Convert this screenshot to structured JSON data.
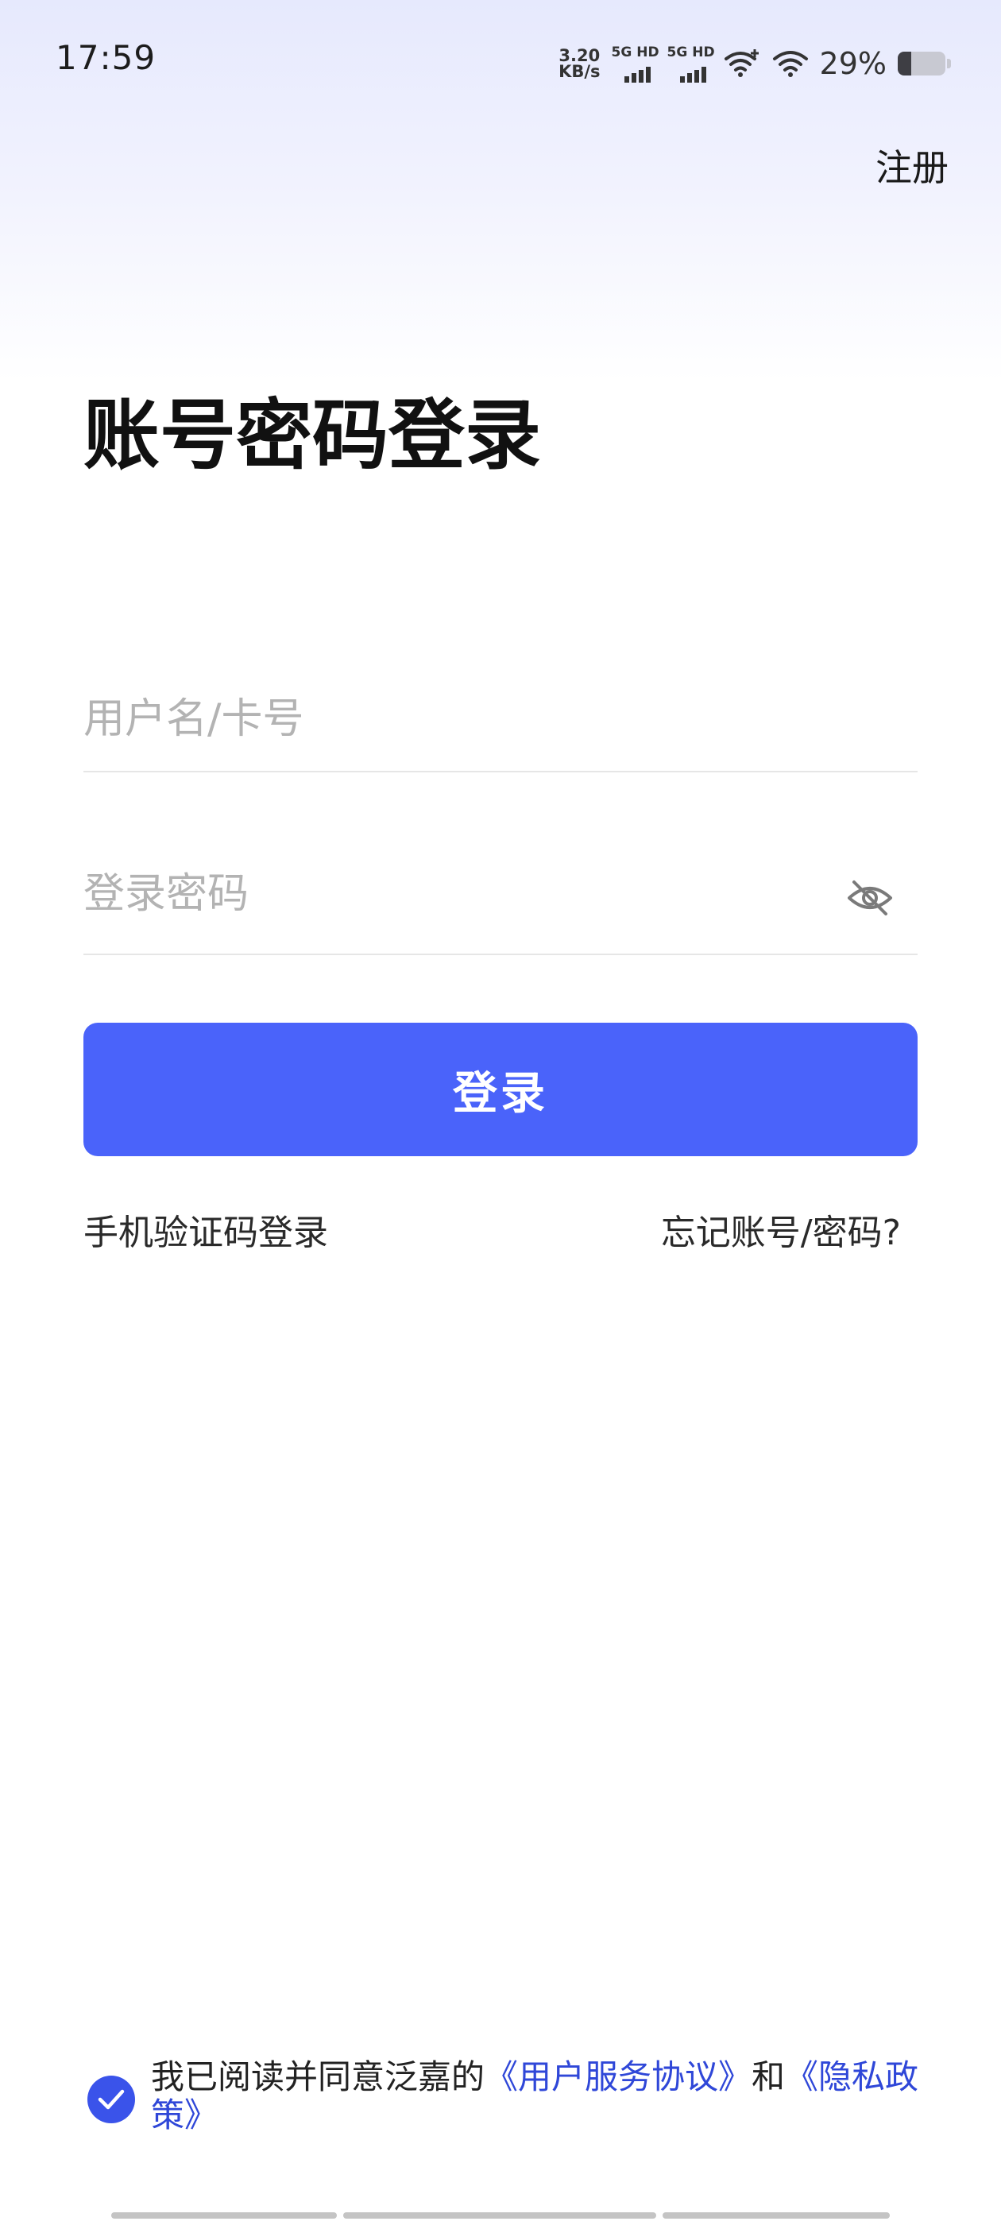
{
  "status_bar": {
    "time": "17:59",
    "net_speed_value": "3.20",
    "net_speed_unit": "KB/s",
    "sim1_label": "5G HD",
    "sim2_label": "5G HD",
    "battery_percent": "29%",
    "battery_level": 0.29,
    "icons": [
      "signal-icon",
      "signal-icon",
      "wifi-plus-icon",
      "wifi-icon",
      "battery-icon"
    ]
  },
  "header": {
    "register_label": "注册"
  },
  "main": {
    "title": "账号密码登录",
    "username_placeholder": "用户名/卡号",
    "password_placeholder": "登录密码",
    "password_toggle_icon": "eye-off-icon",
    "login_button_label": "登录",
    "sms_login_label": "手机验证码登录",
    "forgot_label": "忘记账号/密码?",
    "accent_color": "#4a63fa"
  },
  "agreement": {
    "checked": true,
    "text_prefix": "我已阅读并同意泛嘉的",
    "user_agreement_link": "《用户服务协议》",
    "conjunction": "和",
    "privacy_link": "《隐私政策》"
  }
}
